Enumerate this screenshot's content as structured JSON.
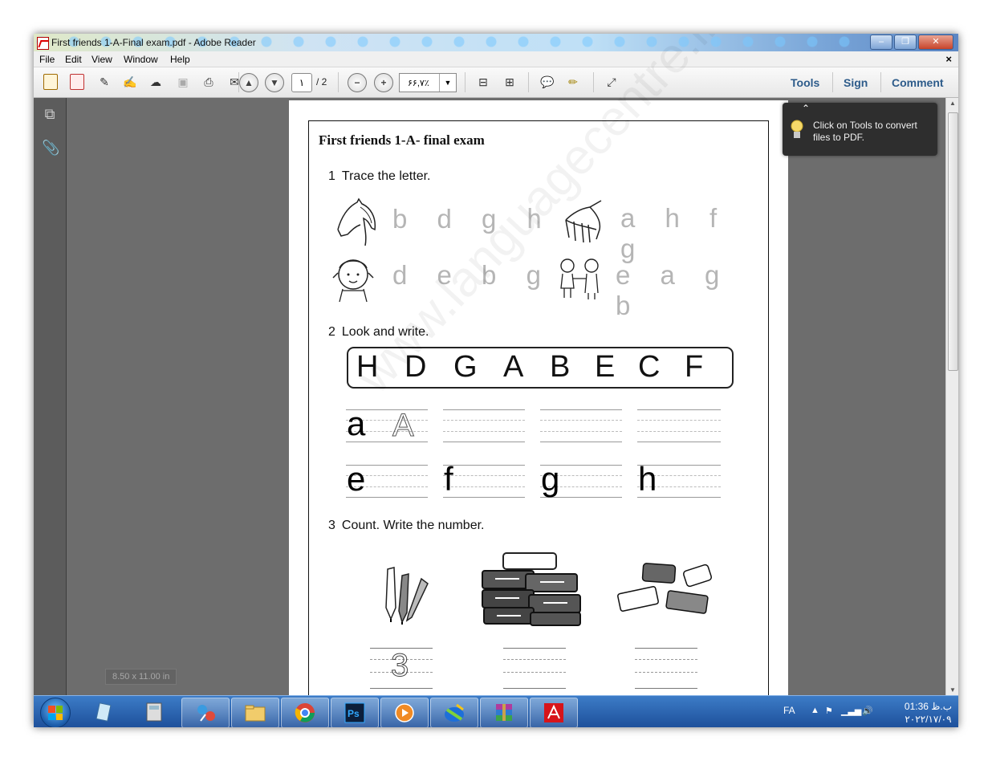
{
  "window": {
    "title": "First friends 1-A-Final exam.pdf - Adobe Reader"
  },
  "menu": {
    "items": [
      "File",
      "Edit",
      "View",
      "Window",
      "Help"
    ],
    "close_glyph": "×"
  },
  "toolbar": {
    "page_current": "١",
    "page_total": "/ 2",
    "zoom_value": "۶۶,۷٪",
    "links": [
      "Tools",
      "Sign",
      "Comment"
    ]
  },
  "tooltip": {
    "line1": "Click on Tools to convert",
    "line2": "files to PDF."
  },
  "status": {
    "page_size": "8.50 x 11.00 in"
  },
  "document": {
    "title": "First friends 1-A- final exam",
    "q1": {
      "num": "1",
      "text": "Trace the letter."
    },
    "q1_rows": [
      {
        "letters": "b d g",
        "traced": "h"
      },
      {
        "letters": "a h f g"
      },
      {
        "letters": "d e b g"
      },
      {
        "letters": "e a g b"
      }
    ],
    "q2": {
      "num": "2",
      "text": "Look and write."
    },
    "capitals": [
      "H",
      "D",
      "G",
      "A",
      "B",
      "E",
      "C",
      "F"
    ],
    "lower_row1": [
      "a",
      "",
      "",
      ""
    ],
    "lower_row2": [
      "e",
      "f",
      "g",
      "h"
    ],
    "traced_capital": "A",
    "q3": {
      "num": "3",
      "text": "Count. Write the number."
    },
    "traced_number": "3",
    "watermark": "www.languagecentre.ir"
  },
  "taskbar": {
    "lang": "FA",
    "time": "01:36 ب.ظ",
    "date": "۲۰۲۲/۱۷/۰۹"
  }
}
